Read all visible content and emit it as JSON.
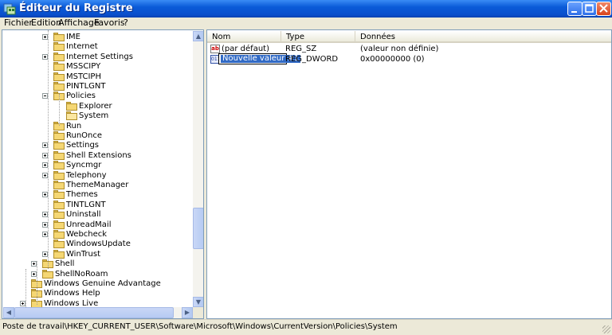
{
  "window": {
    "title": "Éditeur du Registre"
  },
  "menu": [
    {
      "label": "Fichier"
    },
    {
      "label": "Edition"
    },
    {
      "label": "Affichage"
    },
    {
      "label": "Favoris"
    },
    {
      "label": "?"
    }
  ],
  "tree": {
    "items": [
      {
        "label": "IME",
        "expander": "plus"
      },
      {
        "label": "Internet",
        "expander": "none"
      },
      {
        "label": "Internet Settings",
        "expander": "plus"
      },
      {
        "label": "MSSCIPY",
        "expander": "none"
      },
      {
        "label": "MSTCIPH",
        "expander": "none"
      },
      {
        "label": "PINTLGNT",
        "expander": "none"
      },
      {
        "label": "Policies",
        "expander": "minus"
      },
      {
        "label": "Explorer",
        "expander": "none"
      },
      {
        "label": "System",
        "expander": "none",
        "open": true
      },
      {
        "label": "Run",
        "expander": "none"
      },
      {
        "label": "RunOnce",
        "expander": "none"
      },
      {
        "label": "Settings",
        "expander": "plus"
      },
      {
        "label": "Shell Extensions",
        "expander": "plus"
      },
      {
        "label": "Syncmgr",
        "expander": "plus"
      },
      {
        "label": "Telephony",
        "expander": "plus"
      },
      {
        "label": "ThemeManager",
        "expander": "none"
      },
      {
        "label": "Themes",
        "expander": "plus"
      },
      {
        "label": "TINTLGNT",
        "expander": "none"
      },
      {
        "label": "Uninstall",
        "expander": "plus"
      },
      {
        "label": "UnreadMail",
        "expander": "plus"
      },
      {
        "label": "Webcheck",
        "expander": "plus"
      },
      {
        "label": "WindowsUpdate",
        "expander": "none"
      },
      {
        "label": "WinTrust",
        "expander": "plus"
      },
      {
        "label": "Shell",
        "expander": "plus"
      },
      {
        "label": "ShellNoRoam",
        "expander": "plus"
      },
      {
        "label": "Windows Genuine Advantage",
        "expander": "none"
      },
      {
        "label": "Windows Help",
        "expander": "none"
      },
      {
        "label": "Windows Live",
        "expander": "plus"
      }
    ]
  },
  "list": {
    "columns": [
      "Nom",
      "Type",
      "Données"
    ],
    "rows": [
      {
        "icon": "string-value-icon",
        "name": "(par défaut)",
        "type": "REG_SZ",
        "data": "(valeur non définie)"
      },
      {
        "icon": "dword-value-icon",
        "name": "Nouvelle valeur #1",
        "type": "REG_DWORD",
        "data": "0x00000000 (0)",
        "editing": true
      }
    ]
  },
  "statusbar": {
    "path": "Poste de travail\\HKEY_CURRENT_USER\\Software\\Microsoft\\Windows\\CurrentVersion\\Policies\\System"
  },
  "icons": {
    "title": "registry-editor-icon",
    "tree_item": "folder-icon",
    "open_item": "open-folder-icon"
  }
}
